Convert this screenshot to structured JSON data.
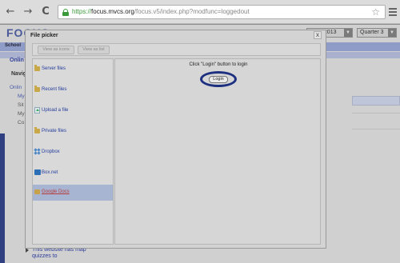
{
  "browser": {
    "back_glyph": "←",
    "forward_glyph": "→",
    "reload_glyph": "C",
    "url_scheme": "https://",
    "url_host": "focus.mvcs.org",
    "url_path": "/focus.v5/index.php?modfunc=loggedout",
    "star_glyph": "☆"
  },
  "background_page": {
    "logo": "FOCUS",
    "year_select": "2012-2013",
    "quarter_select": "Quarter 3",
    "school_label": "School",
    "online_label": "Onlin",
    "nav_heading": "Navig",
    "left_items": [
      "Onlin",
      "My",
      "Sit",
      "My",
      "Co"
    ],
    "bottom_text": "This website has map quizzes to"
  },
  "dialog": {
    "title": "File picker",
    "close_label": "x",
    "view_icons_label": "View as icons",
    "view_list_label": "View as list",
    "repositories": [
      {
        "label": "Server files",
        "icon": "folder-icon"
      },
      {
        "label": "Recent files",
        "icon": "folder-icon"
      },
      {
        "label": "Upload a file",
        "icon": "upload-icon"
      },
      {
        "label": "Private files",
        "icon": "folder-icon"
      },
      {
        "label": "Dropbox",
        "icon": "dropbox-icon"
      },
      {
        "label": "Box.net",
        "icon": "box-icon"
      },
      {
        "label": "Google Docs",
        "icon": "google-docs-icon",
        "selected": true
      }
    ],
    "login_message": "Click \"Login\" button to login",
    "login_button": "Login"
  }
}
